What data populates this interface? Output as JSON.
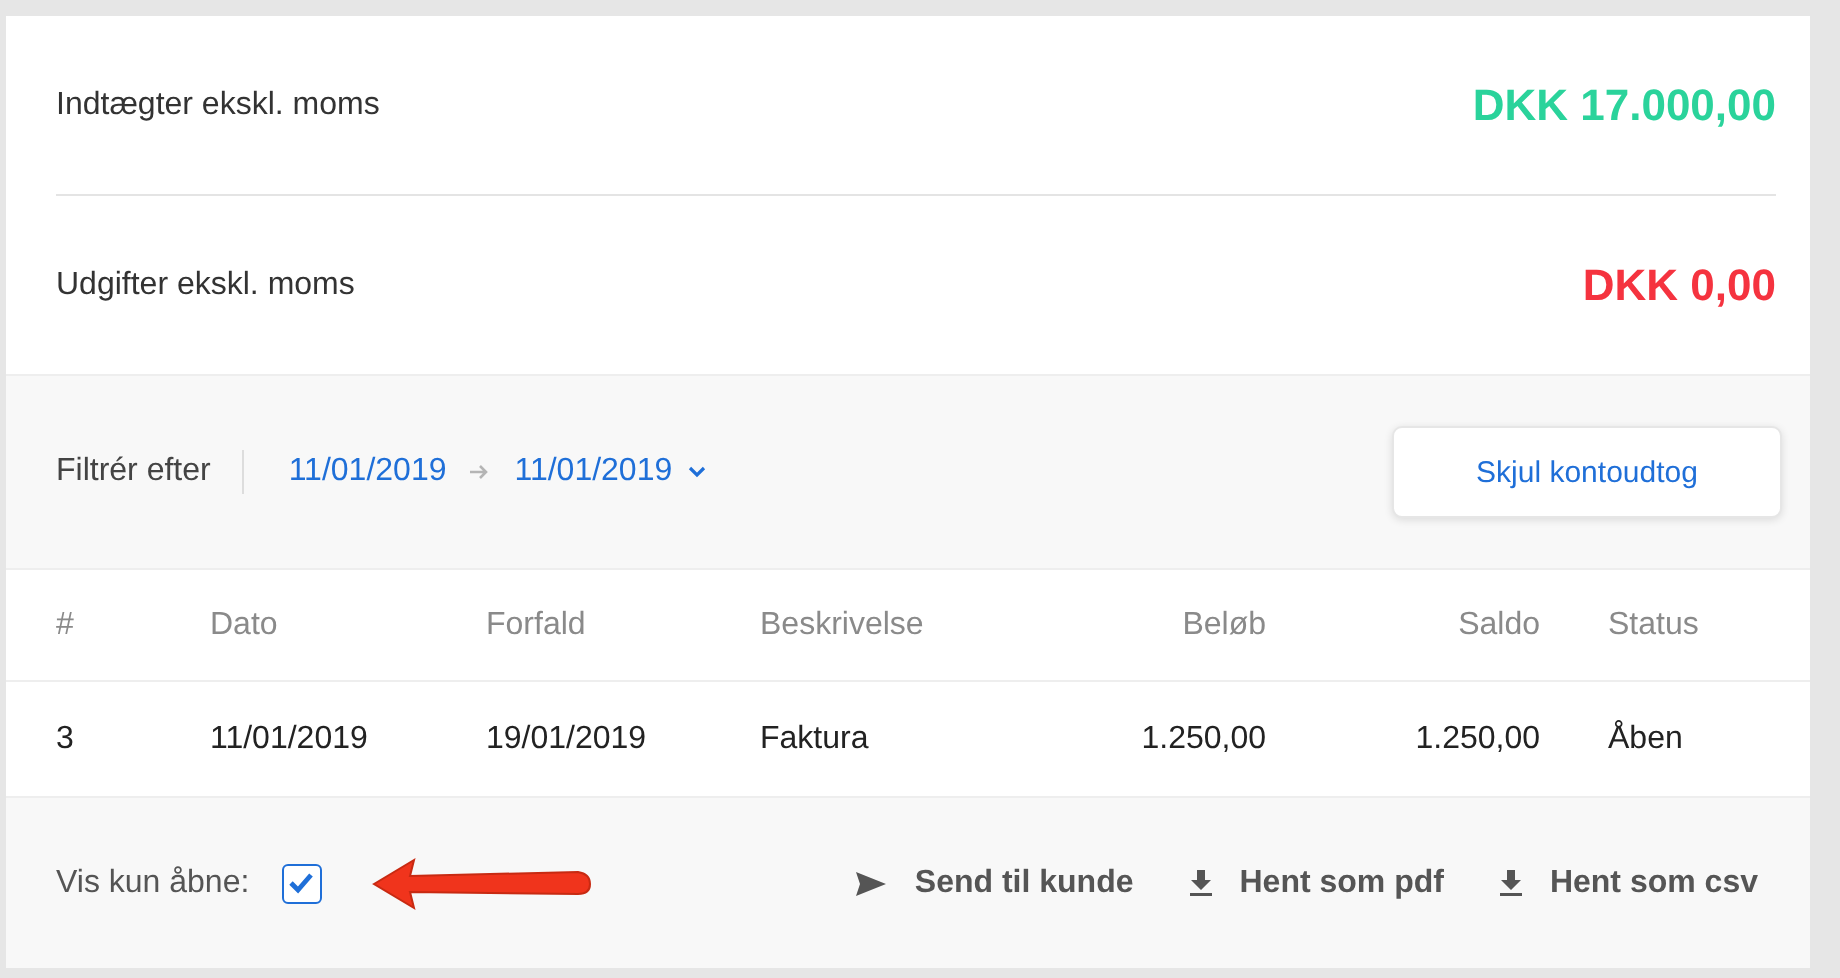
{
  "summary": [
    {
      "label": "Indtægter ekskl. moms",
      "amount": "DKK 17.000,00",
      "color": "#2ad39b"
    },
    {
      "label": "Udgifter ekskl. moms",
      "amount": "DKK 0,00",
      "color": "#f5333f"
    }
  ],
  "filter": {
    "label": "Filtrér efter",
    "from": "11/01/2019",
    "to": "11/01/2019",
    "button": "Skjul kontoudtog"
  },
  "table": {
    "columns": [
      {
        "label": "#",
        "kind": "text"
      },
      {
        "label": "Dato",
        "kind": "text"
      },
      {
        "label": "Forfald",
        "kind": "text"
      },
      {
        "label": "Beskrivelse",
        "kind": "text"
      },
      {
        "label": "Beløb",
        "kind": "amount"
      },
      {
        "label": "Saldo",
        "kind": "amount"
      },
      {
        "label": "Status",
        "kind": "text"
      }
    ],
    "rows": [
      [
        "3",
        "11/01/2019",
        "19/01/2019",
        "Faktura",
        "1.250,00",
        "1.250,00",
        "Åben"
      ]
    ]
  },
  "footer": {
    "checkbox_label": "Vis kun åbne:",
    "checked": true,
    "actions": [
      {
        "label": "Send til kunde",
        "kind": "send"
      },
      {
        "label": "Hent som pdf",
        "kind": "download"
      },
      {
        "label": "Hent som csv",
        "kind": "download"
      }
    ]
  }
}
